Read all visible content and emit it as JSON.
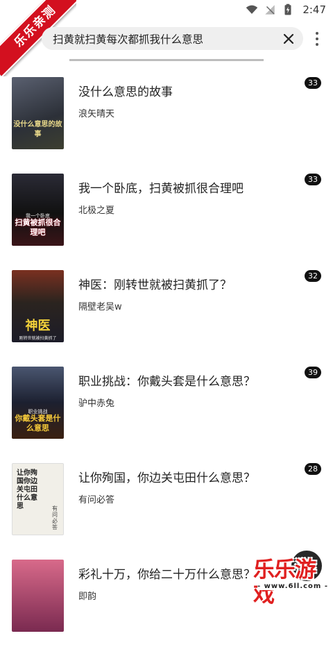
{
  "status": {
    "time": "2:47",
    "icons": [
      "wifi-icon",
      "no-signal-icon",
      "battery-charging-icon"
    ]
  },
  "ribbon": {
    "label": "乐乐亲测"
  },
  "search": {
    "query": "扫黄就扫黄每次都抓我什么意思",
    "clear_icon": "close-icon",
    "menu_icon": "more-vert-icon"
  },
  "results": [
    {
      "title": "没什么意思的故事",
      "author": "浪矢晴天",
      "count": "33",
      "cover_text": "没什么意思的故事",
      "cover_sub": "",
      "cover_bg": "#3a3f48"
    },
    {
      "title": "我一个卧底，扫黄被抓很合理吧",
      "author": "北极之夏",
      "count": "33",
      "cover_text": "扫黄被抓很合理吧",
      "cover_sub": "我一个卧底",
      "cover_bg": "#1d1d24"
    },
    {
      "title": "神医：刚转世就被扫黄抓了？",
      "author": "隔壁老吴w",
      "count": "32",
      "cover_text": "神医",
      "cover_sub": "刚转世就被扫黄抓了",
      "cover_bg": "#2a2018"
    },
    {
      "title": "职业挑战：你戴头套是什么意思？",
      "author": "驴中赤兔",
      "count": "39",
      "cover_text": "你戴头套是什么意思",
      "cover_sub": "职业挑战",
      "cover_bg": "#262a36"
    },
    {
      "title": "让你殉国，你边关屯田什么意思？",
      "author": "有问必答",
      "count": "28",
      "cover_text": "让你殉国你边关屯田什么意思",
      "cover_sub": "有问必答",
      "cover_bg": "#f1efe8"
    },
    {
      "title": "彩礼十万，你给二十万什么意思？",
      "author": "即韵",
      "count": "",
      "cover_text": "",
      "cover_sub": "",
      "cover_bg": "#b0466a"
    }
  ],
  "watermark": {
    "brand": "乐乐游戏",
    "url": "- www.6ll.com -"
  },
  "colors": {
    "accent": "#d3101f",
    "badge": "#111111"
  }
}
